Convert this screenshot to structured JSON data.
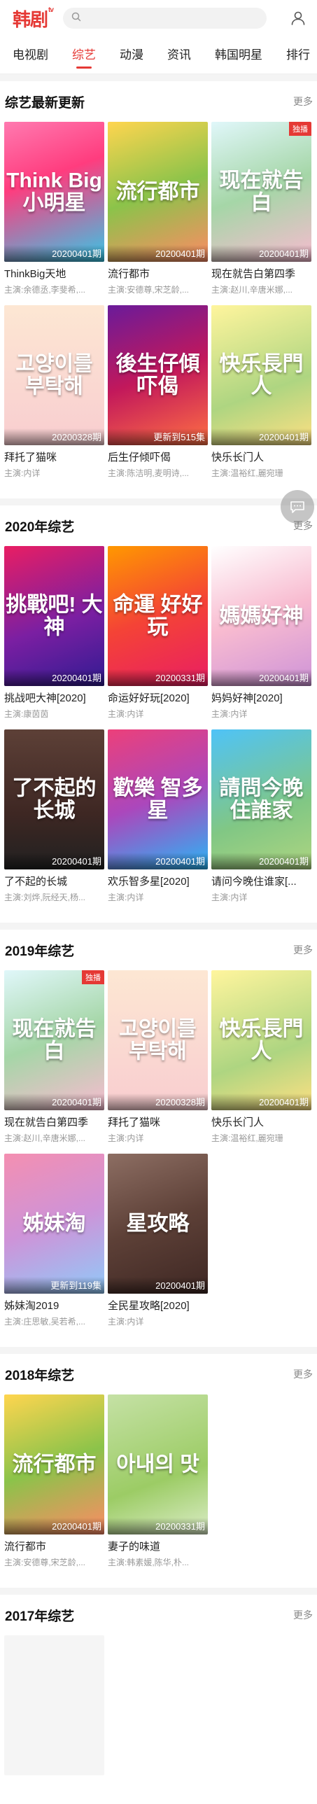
{
  "header": {
    "logo": "韩剧",
    "logo_sup": "tv",
    "search_placeholder": ""
  },
  "tabs": [
    "电视剧",
    "综艺",
    "动漫",
    "资讯",
    "韩国明星",
    "排行"
  ],
  "sections": [
    {
      "title": "综艺最新更新",
      "more": "更多",
      "items": [
        {
          "title": "ThinkBig天地",
          "cast": "主演:余德丞,李斐希,...",
          "badge": "20200401期",
          "poster_text": "Think Big 小明星",
          "bg": "linear-gradient(160deg,#ff7ab0 0%,#ff3c7e 40%,#34c8e8 100%)",
          "tag": ""
        },
        {
          "title": "流行都市",
          "cast": "主演:安德尊,宋芝龄,...",
          "badge": "20200401期",
          "poster_text": "流行都市",
          "bg": "linear-gradient(160deg,#ffd54f 0%,#8bc34a 50%,#ff8a65 100%)",
          "tag": ""
        },
        {
          "title": "现在就告白第四季",
          "cast": "主演:赵川,辛唐米娜,...",
          "badge": "20200401期",
          "poster_text": "现在就告白",
          "bg": "linear-gradient(160deg,#e0f7fa 0%,#a5d6a7 50%,#f8bbd0 100%)",
          "tag": "独播"
        },
        {
          "title": "拜托了猫咪",
          "cast": "主演:内详",
          "badge": "20200328期",
          "poster_text": "고양이를 부탁해",
          "bg": "linear-gradient(180deg,#fde7d3 0%,#f8cdd0 100%)",
          "tag": ""
        },
        {
          "title": "后生仔倾吓偈",
          "cast": "主演:陈洁明,麦明诗,...",
          "badge": "更新到515集",
          "poster_text": "後生仔傾吓偈",
          "bg": "linear-gradient(160deg,#6a1b9a 0%,#c2185b 50%,#ff7043 100%)",
          "tag": ""
        },
        {
          "title": "快乐长门人",
          "cast": "主演:温裕红,麗宛珊",
          "badge": "20200401期",
          "poster_text": "快乐長門人",
          "bg": "linear-gradient(160deg,#fff59d 0%,#aed581 60%,#ffe082 100%)",
          "tag": ""
        }
      ]
    },
    {
      "title": "2020年综艺",
      "more": "更多",
      "items": [
        {
          "title": "挑战吧大神[2020]",
          "cast": "主演:康茵茵",
          "badge": "20200401期",
          "poster_text": "挑戰吧! 大神",
          "bg": "linear-gradient(160deg,#e91e63 0%,#7b1fa2 55%,#311b92 100%)",
          "tag": ""
        },
        {
          "title": "命运好好玩[2020]",
          "cast": "主演:内详",
          "badge": "20200331期",
          "poster_text": "命運 好好玩",
          "bg": "linear-gradient(160deg,#ff9800 0%,#f44336 50%,#e91e63 100%)",
          "tag": ""
        },
        {
          "title": "妈妈好神[2020]",
          "cast": "主演:内详",
          "badge": "20200401期",
          "poster_text": "媽媽好神",
          "bg": "linear-gradient(160deg,#ffffff 0%,#f8bbd0 50%,#ce93d8 100%)",
          "tag": ""
        },
        {
          "title": "了不起的长城",
          "cast": "主演:刘烨,阮经天,杨...",
          "badge": "20200401期",
          "poster_text": "了不起的长城",
          "bg": "linear-gradient(180deg,#5d4037 0%,#3e2723 60%,#212121 100%)",
          "tag": ""
        },
        {
          "title": "欢乐智多星[2020]",
          "cast": "主演:内详",
          "badge": "20200401期",
          "poster_text": "歡樂 智多星",
          "bg": "linear-gradient(160deg,#ec407a 0%,#ab47bc 50%,#29b6f6 100%)",
          "tag": ""
        },
        {
          "title": "请问今晚住谁家[...",
          "cast": "主演:内详",
          "badge": "20200401期",
          "poster_text": "請問今晚 住誰家",
          "bg": "linear-gradient(160deg,#4fc3f7 0%,#81c784 60%,#aed581 100%)",
          "tag": ""
        }
      ]
    },
    {
      "title": "2019年综艺",
      "more": "更多",
      "items": [
        {
          "title": "现在就告白第四季",
          "cast": "主演:赵川,辛唐米娜,...",
          "badge": "20200401期",
          "poster_text": "现在就告白",
          "bg": "linear-gradient(160deg,#e0f7fa 0%,#a5d6a7 50%,#f8bbd0 100%)",
          "tag": "独播"
        },
        {
          "title": "拜托了猫咪",
          "cast": "主演:内详",
          "badge": "20200328期",
          "poster_text": "고양이를 부탁해",
          "bg": "linear-gradient(180deg,#fde7d3 0%,#f8cdd0 100%)",
          "tag": ""
        },
        {
          "title": "快乐长门人",
          "cast": "主演:温裕红,麗宛珊",
          "badge": "20200401期",
          "poster_text": "快乐長門人",
          "bg": "linear-gradient(160deg,#fff59d 0%,#aed581 60%,#ffe082 100%)",
          "tag": ""
        },
        {
          "title": "姊妹淘2019",
          "cast": "主演:庄思敏,吴若希,...",
          "badge": "更新到119集",
          "poster_text": "姊妹淘",
          "bg": "linear-gradient(160deg,#f48fb1 0%,#ce93d8 50%,#90caf9 100%)",
          "tag": ""
        },
        {
          "title": "全民星攻略[2020]",
          "cast": "主演:内详",
          "badge": "20200401期",
          "poster_text": "星攻略",
          "bg": "linear-gradient(160deg,#8d6e63 0%,#5d4037 50%,#3e2723 100%)",
          "tag": ""
        }
      ]
    },
    {
      "title": "2018年综艺",
      "more": "更多",
      "items": [
        {
          "title": "流行都市",
          "cast": "主演:安德尊,宋芝龄,...",
          "badge": "20200401期",
          "poster_text": "流行都市",
          "bg": "linear-gradient(160deg,#ffd54f 0%,#8bc34a 50%,#ff8a65 100%)",
          "tag": ""
        },
        {
          "title": "妻子的味道",
          "cast": "主演:韩素媛,陈华,朴...",
          "badge": "20200331期",
          "poster_text": "아내의 맛",
          "bg": "linear-gradient(160deg,#c5e1a5 0%,#9ccc65 60%,#dcedc8 100%)",
          "tag": ""
        }
      ]
    },
    {
      "title": "2017年综艺",
      "more": "更多",
      "items": [
        {
          "title": "",
          "cast": "",
          "badge": "",
          "poster_text": "",
          "bg": "#f5f5f5",
          "tag": ""
        }
      ]
    }
  ]
}
